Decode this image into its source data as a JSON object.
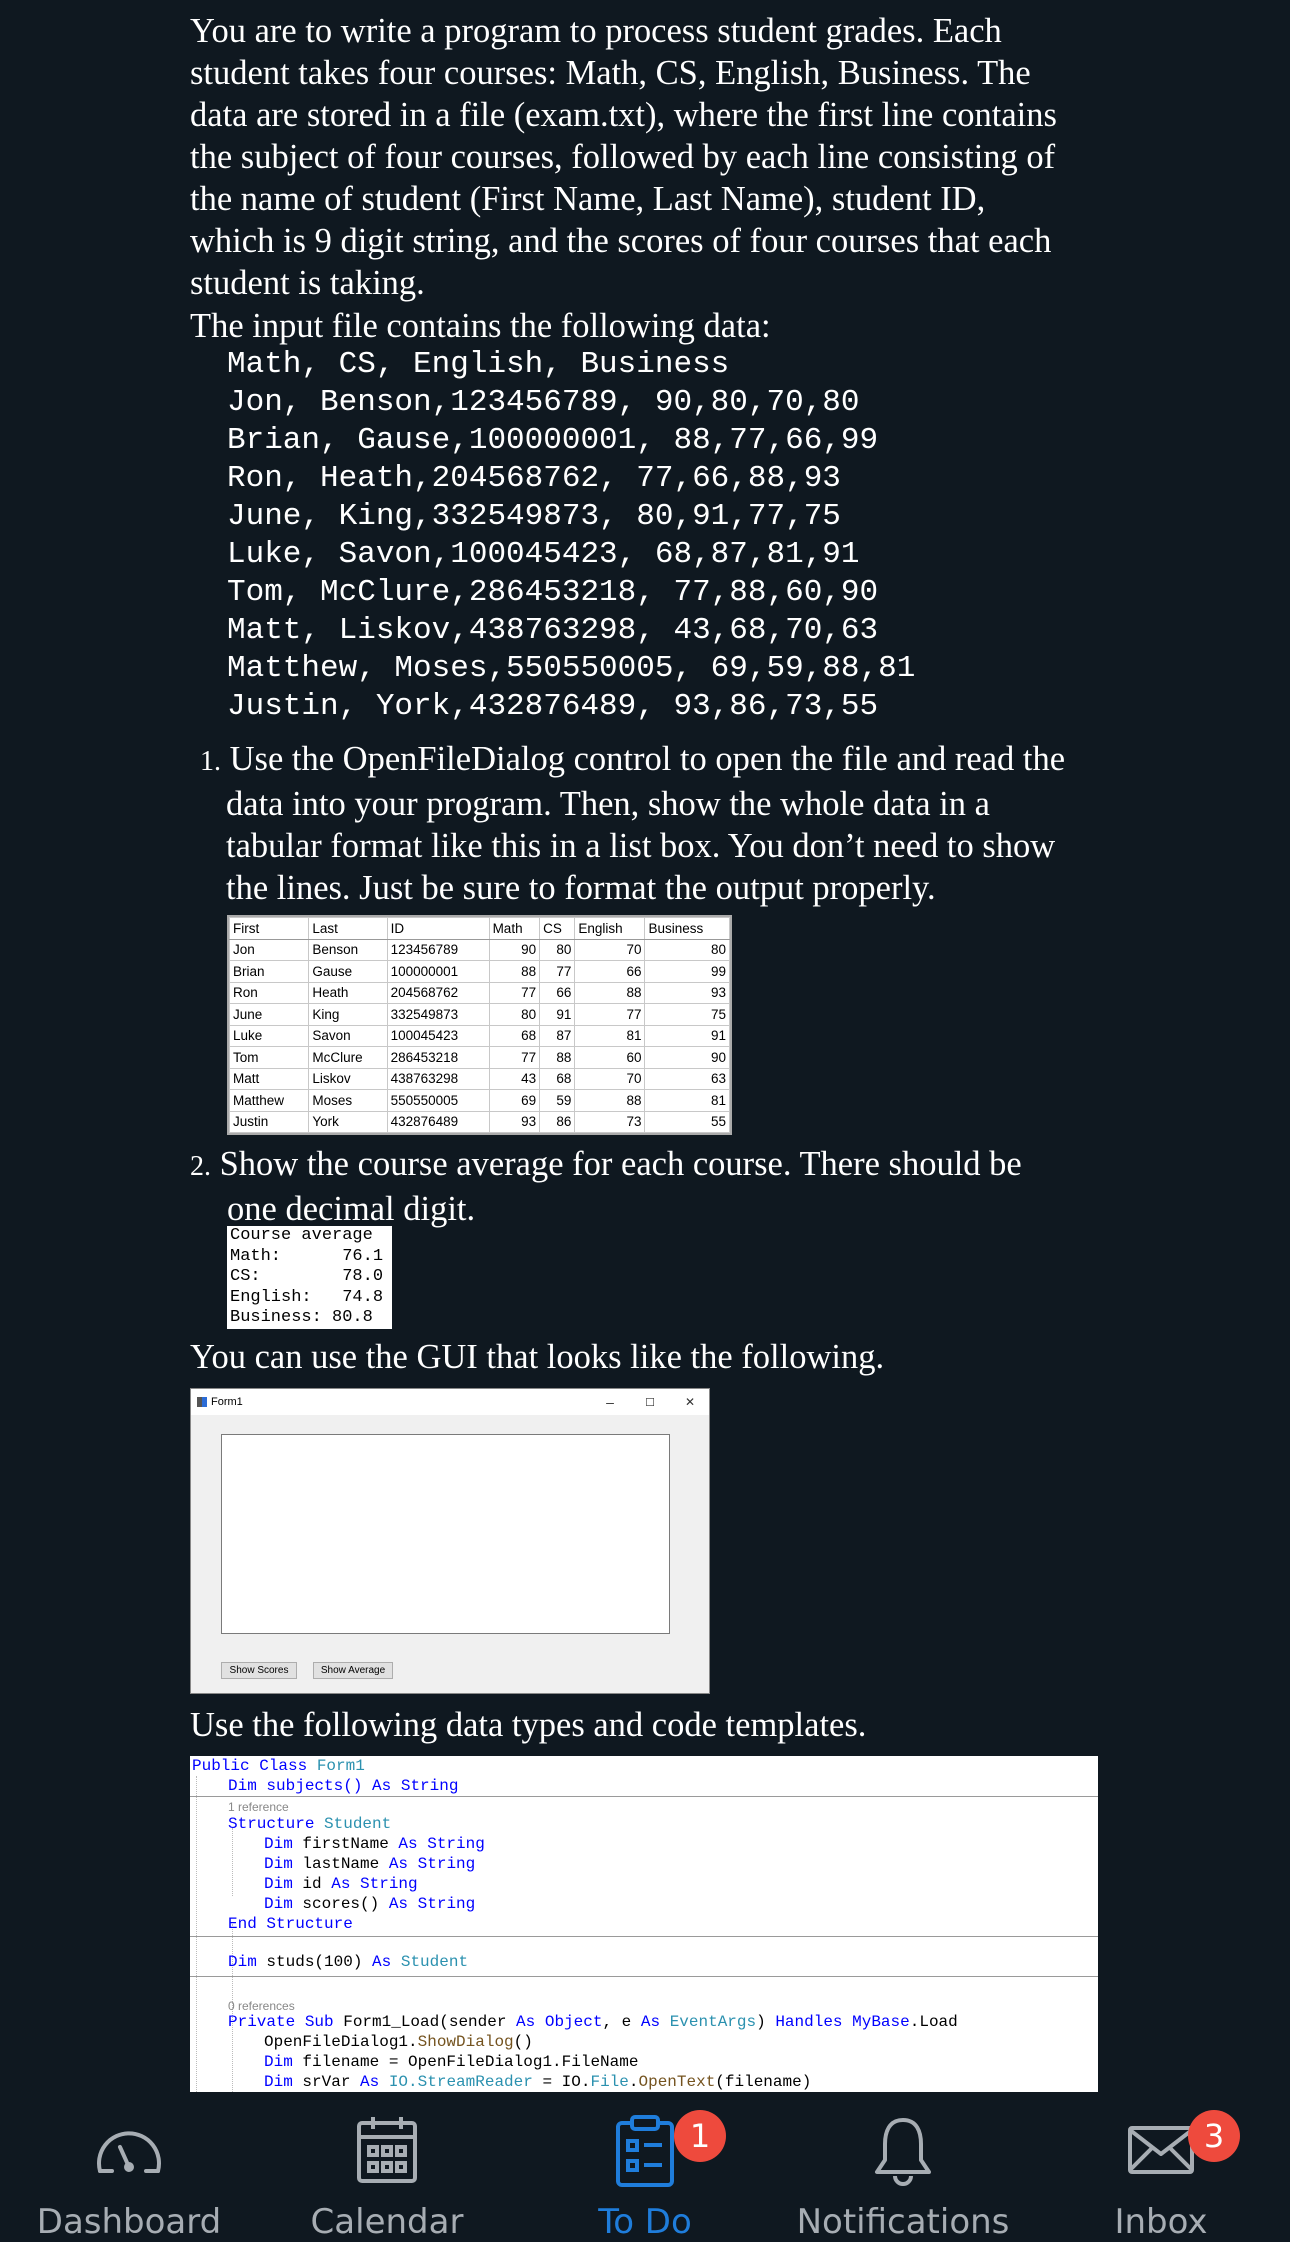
{
  "problem": {
    "intro_lines": [
      "You are to write a program to process student grades. Each",
      "student takes four courses: Math, CS, English, Business. The",
      "data are stored in a file (exam.txt), where the first line contains",
      "the subject of four courses, followed by each line consisting of",
      "the name of student (First Name, Last Name), student ID,",
      "which is 9 digit string, and the scores of four courses that each",
      "student is taking."
    ],
    "input_intro": "The input file contains the following data:",
    "input_data_lines": [
      "Math, CS, English, Business",
      "Jon, Benson,123456789, 90,80,70,80",
      "Brian, Gause,100000001, 88,77,66,99",
      "Ron, Heath,204568762, 77,66,88,93",
      "June, King,332549873, 80,91,77,75",
      "Luke, Savon,100045423, 68,87,81,91",
      "Tom, McClure,286453218, 77,88,60,90",
      "Matt, Liskov,438763298, 43,68,70,63",
      "Matthew, Moses,550550005, 69,59,88,81",
      "Justin, York,432876489, 93,86,73,55"
    ],
    "item1": {
      "number": "1.",
      "first_line": "Use the OpenFileDialog control to open the file and read the",
      "rest_lines": [
        "data into your program. Then, show the whole data in a",
        "tabular format like this in a list box. You don’t need to show",
        "the lines. Just be sure to format the output properly."
      ]
    },
    "table": {
      "headers": [
        "First",
        "Last",
        "ID",
        "Math",
        "CS",
        "English",
        "Business"
      ],
      "rows": [
        [
          "Jon",
          "Benson",
          "123456789",
          "90",
          "80",
          "70",
          "80"
        ],
        [
          "Brian",
          "Gause",
          "100000001",
          "88",
          "77",
          "66",
          "99"
        ],
        [
          "Ron",
          "Heath",
          "204568762",
          "77",
          "66",
          "88",
          "93"
        ],
        [
          "June",
          "King",
          "332549873",
          "80",
          "91",
          "77",
          "75"
        ],
        [
          "Luke",
          "Savon",
          "100045423",
          "68",
          "87",
          "81",
          "91"
        ],
        [
          "Tom",
          "McClure",
          "286453218",
          "77",
          "88",
          "60",
          "90"
        ],
        [
          "Matt",
          "Liskov",
          "438763298",
          "43",
          "68",
          "70",
          "63"
        ],
        [
          "Matthew",
          "Moses",
          "550550005",
          "69",
          "59",
          "88",
          "81"
        ],
        [
          "Justin",
          "York",
          "432876489",
          "93",
          "86",
          "73",
          "55"
        ]
      ]
    },
    "item2": {
      "number": "2.",
      "first_line": "Show the course average for each course. There should be",
      "rest_lines": [
        "one decimal digit."
      ]
    },
    "course_average_lines": [
      "Course average",
      "Math:      76.1",
      "CS:        78.0",
      "English:   74.8",
      "Business: 80.8"
    ],
    "gui_intro": "You can use the GUI that looks like the following.",
    "form": {
      "title": "Form1",
      "minimize": "–",
      "maximize": "☐",
      "close": "✕",
      "button_show_scores": "Show Scores",
      "button_show_average": "Show Average"
    },
    "templates_intro": "Use the following data types and code templates."
  },
  "code": {
    "l1a": "Public Class ",
    "l1b": "Form1",
    "l2a": "Dim subjects() ",
    "l2b": "As String",
    "l3": "1 reference",
    "l4a": "Structure ",
    "l4b": "Student",
    "l5a": "Dim ",
    "l5b": "firstName ",
    "l5c": "As String",
    "l6a": "Dim ",
    "l6b": "lastName ",
    "l6c": "As String",
    "l7a": "Dim ",
    "l7b": "id ",
    "l7c": "As String",
    "l8a": "Dim ",
    "l8b": "scores() ",
    "l8c": "As String",
    "l9": "End Structure",
    "l10a": "Dim ",
    "l10b": "studs(100) ",
    "l10c": "As ",
    "l10d": "Student",
    "l11": "0 references",
    "l12a": "Private Sub ",
    "l12b": "Form1_Load(sender ",
    "l12c": "As Object",
    "l12d": ", e ",
    "l12e": "As ",
    "l12f": "EventArgs",
    "l12g": ") ",
    "l12h": "Handles MyBase",
    "l12i": ".Load",
    "l13a": "OpenFileDialog1.",
    "l13b": "ShowDialog",
    "l13c": "()",
    "l14a": "Dim ",
    "l14b": "filename = OpenFileDialog1.FileName",
    "l15a": "Dim ",
    "l15b": "srVar ",
    "l15c": "As ",
    "l15d": "IO.StreamReader",
    "l15e": " = IO.",
    "l15f": "File",
    "l15g": ".",
    "l15h": "OpenText",
    "l15i": "(filename)"
  },
  "tabbar": {
    "tabs": [
      {
        "label": "Dashboard",
        "icon": "gauge-icon"
      },
      {
        "label": "Calendar",
        "icon": "calendar-icon"
      },
      {
        "label": "To Do",
        "icon": "clipboard-icon",
        "badge": "1"
      },
      {
        "label": "Notifications",
        "icon": "bell-icon"
      },
      {
        "label": "Inbox",
        "icon": "envelope-icon",
        "badge": "3"
      }
    ],
    "active_color": "#1f7ddb",
    "inactive_color": "#a7adb3",
    "badge_color": "#ee4a3d"
  }
}
